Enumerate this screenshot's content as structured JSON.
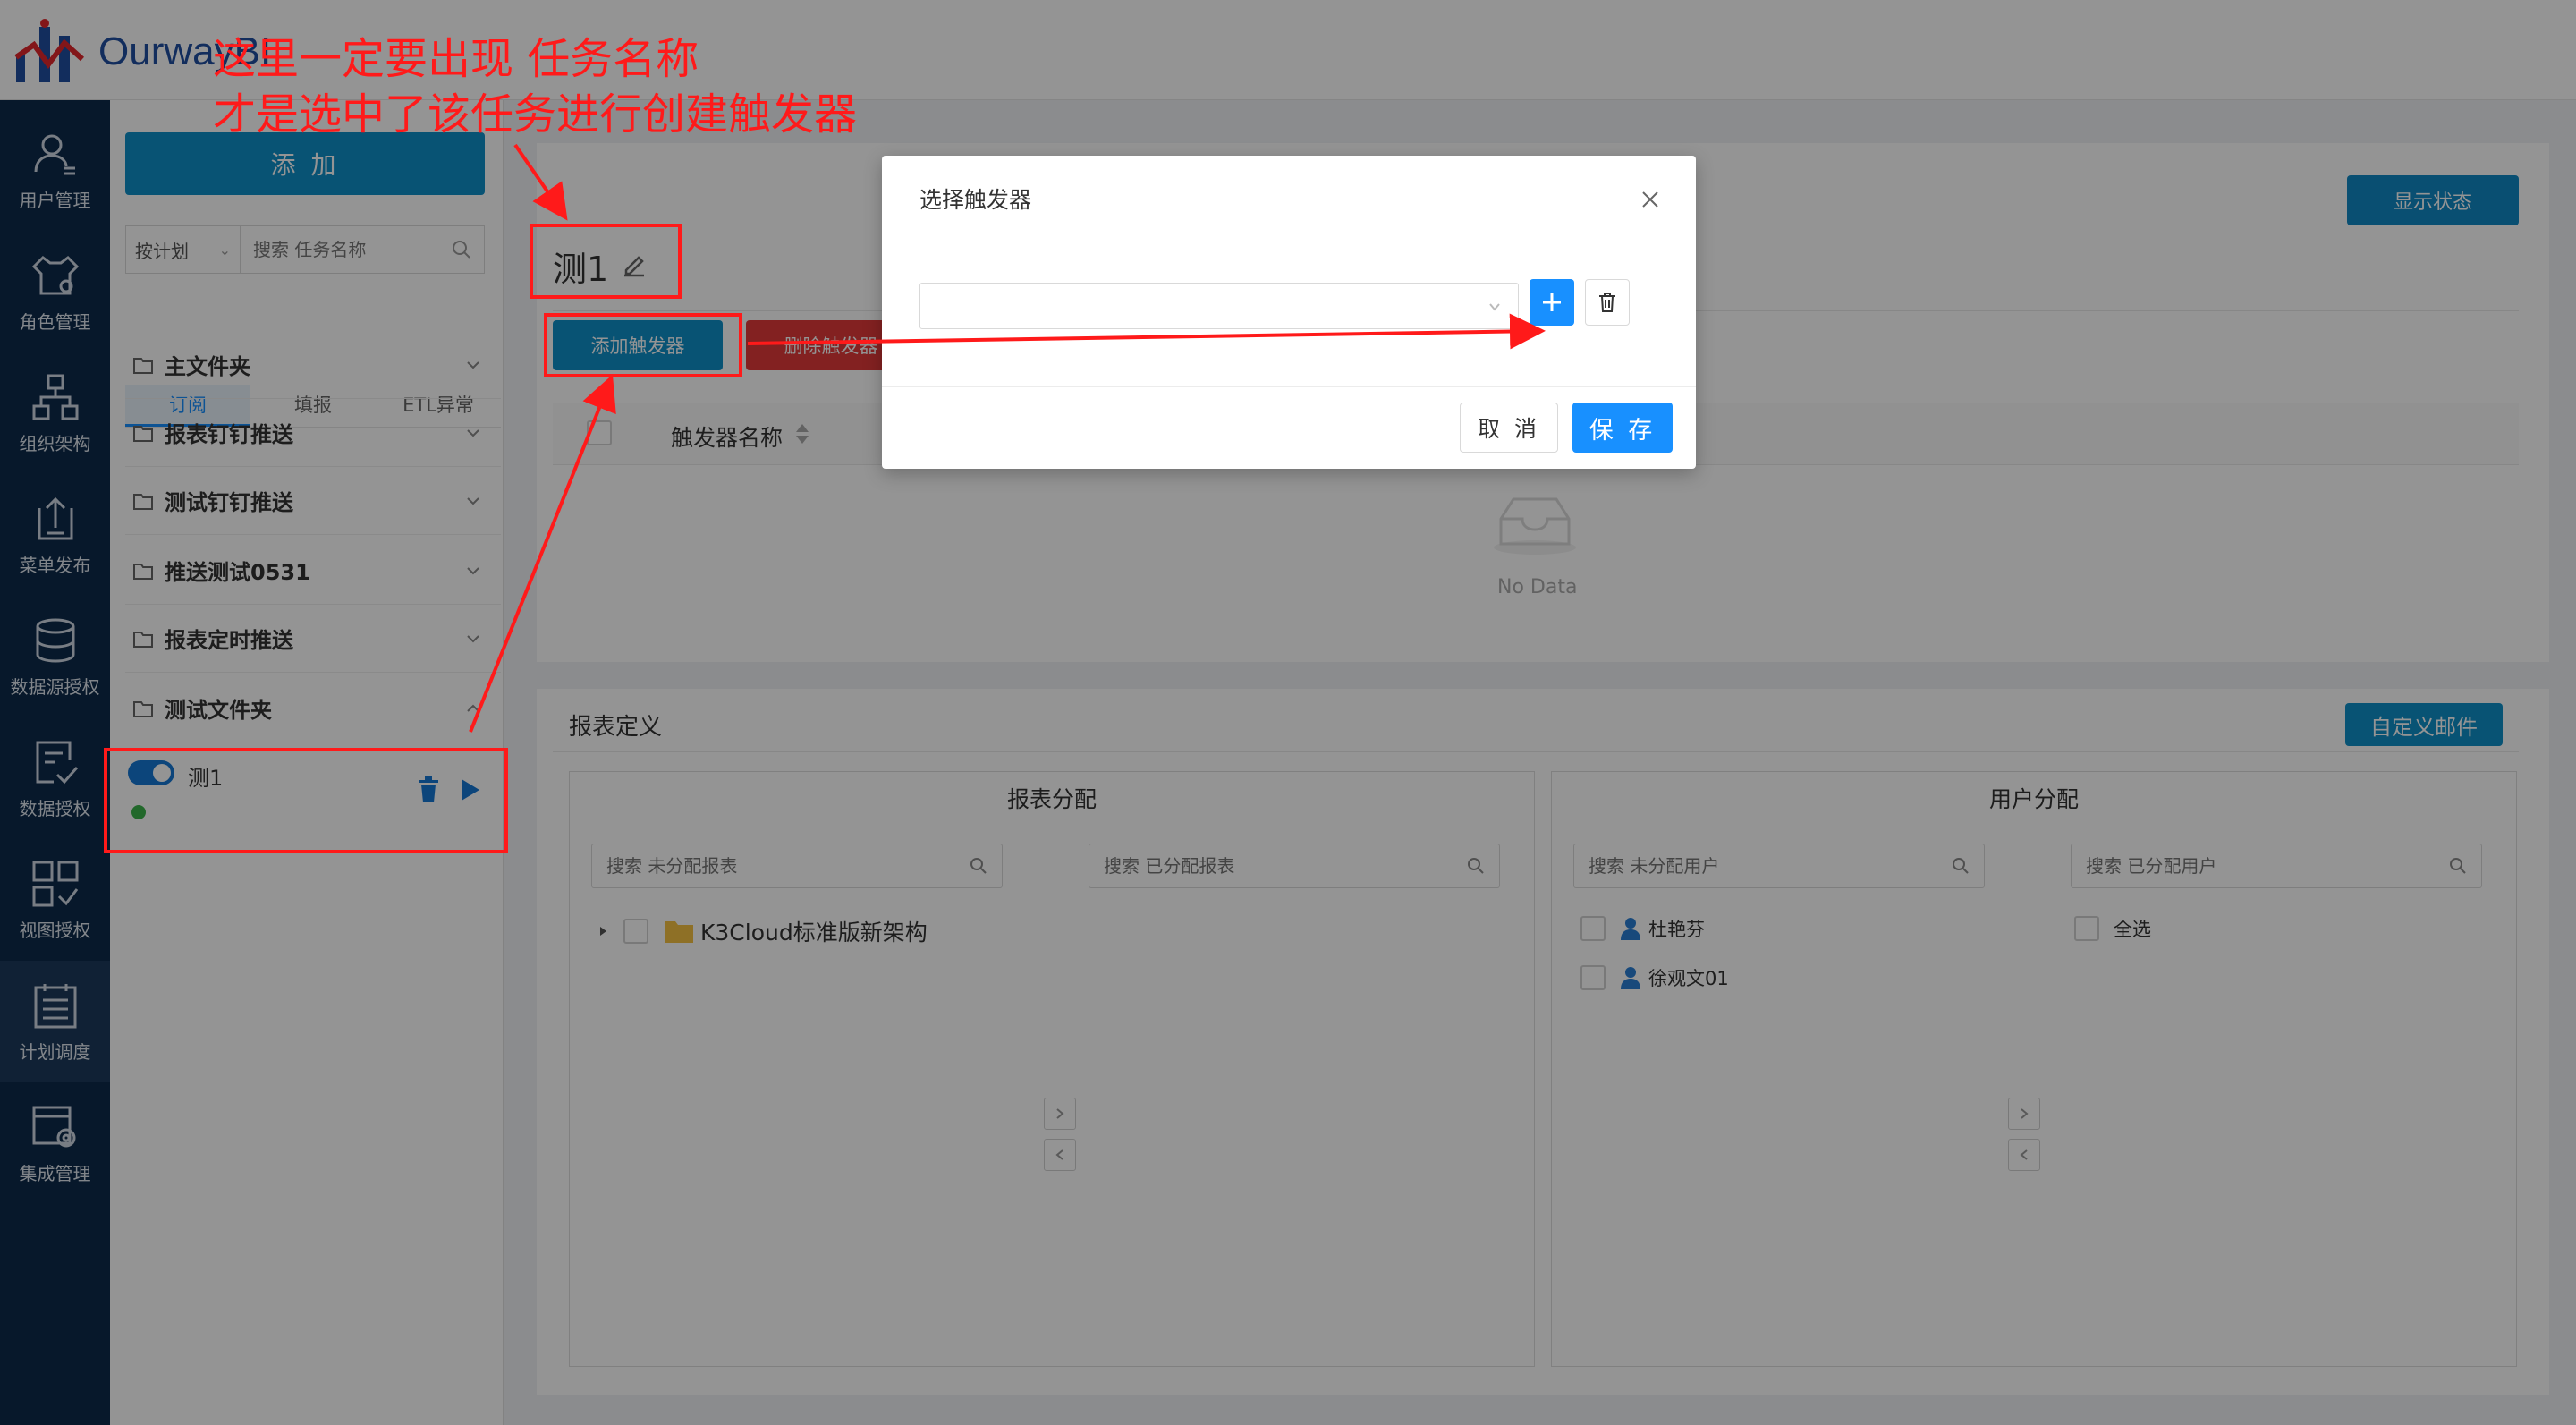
{
  "header": {
    "logo_text": "OurwayBI"
  },
  "nav": {
    "items": [
      {
        "label": "用户管理",
        "icon": "user-icon"
      },
      {
        "label": "角色管理",
        "icon": "role-icon"
      },
      {
        "label": "组织架构",
        "icon": "org-chart-icon"
      },
      {
        "label": "菜单发布",
        "icon": "publish-icon"
      },
      {
        "label": "数据源授权",
        "icon": "database-icon"
      },
      {
        "label": "数据授权",
        "icon": "data-auth-icon"
      },
      {
        "label": "视图授权",
        "icon": "view-auth-icon"
      },
      {
        "label": "计划调度",
        "icon": "schedule-icon"
      },
      {
        "label": "集成管理",
        "icon": "integration-icon"
      }
    ],
    "active_index": 7
  },
  "tasks": {
    "add_label": "添 加",
    "plan_filter": "按计划",
    "search_placeholder": "搜索 任务名称",
    "tabs": [
      "订阅",
      "填报",
      "ETL异常"
    ],
    "active_tab": 0,
    "folders": [
      "主文件夹",
      "报表钉钉推送",
      "测试钉钉推送",
      "推送测试0531",
      "报表定时推送",
      "测试文件夹"
    ],
    "expanded_folder": 5,
    "task": {
      "name": "测1",
      "enabled": true,
      "status_color": "#3bb34a"
    }
  },
  "detail": {
    "task_title": "测1",
    "status_button": "显示状态",
    "add_trigger": "添加触发器",
    "delete_trigger": "删除触发器",
    "trigger_column": "触发器名称",
    "empty_text": "No Data",
    "report_section": "报表定义",
    "custom_mail": "自定义邮件",
    "report_panel": {
      "title": "报表分配",
      "search_unassigned": "搜索 未分配报表",
      "search_assigned": "搜索 已分配报表",
      "tree_root": "K3Cloud标准版新架构"
    },
    "user_panel": {
      "title": "用户分配",
      "search_unassigned": "搜索 未分配用户",
      "search_assigned": "搜索 已分配用户",
      "users": [
        "杜艳芬",
        "徐观文01"
      ],
      "select_all": "全选"
    }
  },
  "modal": {
    "title": "选择触发器",
    "cancel": "取 消",
    "save": "保 存"
  },
  "annotation": {
    "line1": "这里一定要出现 任务名称",
    "line2": "才是选中了该任务进行创建触发器",
    "color": "#ff1a1a"
  },
  "colors": {
    "primary": "#0f8fc9",
    "accent": "#1890ff",
    "danger": "#e23a3a",
    "nav_bg": "#0d2a4a"
  }
}
